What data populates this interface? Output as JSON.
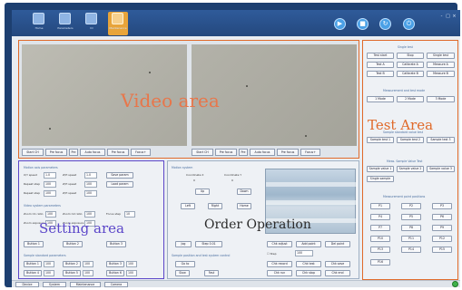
{
  "toolbar": {
    "items": [
      {
        "label": "Home",
        "icon": "home-icon"
      },
      {
        "label": "Parameters",
        "icon": "parameters-icon"
      },
      {
        "label": "IO",
        "icon": "io-icon"
      },
      {
        "label": "Maintenance",
        "icon": "maintenance-icon"
      }
    ],
    "round_buttons": [
      {
        "icon": "play-icon",
        "glyph": "▶"
      },
      {
        "icon": "stop-icon",
        "glyph": "■"
      },
      {
        "icon": "reset-icon",
        "glyph": "↻"
      },
      {
        "icon": "power-icon",
        "glyph": "⏻"
      }
    ],
    "window_controls": [
      "-",
      "□",
      "×"
    ]
  },
  "video": {
    "overlay_label": "Video area",
    "left_controls": [
      "Start CH",
      "Pre focus",
      "Pre",
      "Auto focus",
      "Pre focus",
      "Focus+"
    ],
    "right_controls": [
      "Start CH",
      "Pre focus",
      "Pre",
      "Auto focus",
      "Pre focus",
      "Focus+"
    ]
  },
  "test": {
    "overlay_label": "Test Area",
    "title": "Single test",
    "row1": [
      "Test start",
      "Stop",
      "Single test"
    ],
    "row2": [
      "Test A",
      "Calibrate A",
      "Measure A"
    ],
    "row3": [
      "Test B",
      "Calibrate B",
      "Measure B"
    ],
    "mode_title": "Measurement and test mode",
    "modes": [
      "1 Mode",
      "2 Mode",
      "3 Mode"
    ],
    "sample_title": "Sample standard value test",
    "samples": [
      "Sample test 1",
      "Sample test 2",
      "Sample test 3"
    ],
    "meas_title": "Meas. Sample Value Test",
    "meas": [
      "Sample value 1",
      "Sample value 2",
      "Sample value 3"
    ],
    "single_sample": "Single sample",
    "point_title": "Measurement point positions",
    "points": [
      "P1",
      "P2",
      "P3",
      "P4",
      "P5",
      "P6",
      "P7",
      "P8",
      "P9",
      "P10",
      "P11",
      "P12",
      "P13",
      "P14",
      "P15",
      "P16"
    ]
  },
  "setting": {
    "overlay_label": "Setting area",
    "sec1": "Motion axis parameters",
    "rows1": [
      [
        "X/Y speed",
        "1.0",
        "Z/H speed",
        "1.0",
        "Save param"
      ],
      [
        "Repeat step",
        "100",
        "Z/H speed",
        "100",
        "Load param"
      ],
      [
        "Repeat step",
        "100",
        "Z/H speed",
        "100",
        ""
      ]
    ],
    "sec2": "Video system parameters",
    "rows2": [
      [
        "Zoom C1 ratio",
        "100",
        "Zoom C2 ratio",
        "100",
        "Focus step",
        "10"
      ],
      [
        "Zoom exposure",
        "100",
        "Zoom exposure",
        "100",
        "Focus step",
        "10"
      ]
    ],
    "rows3": [
      "Button 1",
      "Button 2",
      "Button 3"
    ],
    "sec4": "Sample standard parameters",
    "rows4": [
      [
        "Button 1",
        "100",
        "Button 2",
        "100",
        "Button 3",
        "100"
      ],
      [
        "Button 4",
        "100",
        "Button 5",
        "100",
        "Button 6",
        "100"
      ]
    ]
  },
  "order": {
    "overlay_label": "Order Operation",
    "sec1": "Motion system",
    "coord_x": "Coordinate X",
    "coord_y": "Coordinate Y",
    "x_val": "0",
    "y_val": "0",
    "jog": [
      "Up",
      "Down",
      "Left",
      "Right",
      "Home"
    ],
    "row_a": [
      "Jog",
      "Step 0.01"
    ],
    "sec2": "Sample position and test system control",
    "row_b": [
      "Go to",
      "Slow",
      "Fast"
    ],
    "checkbox": "Step",
    "select_value": "100",
    "right_btns": [
      "Chk adjust",
      "Add point",
      "Del point"
    ],
    "right_btns2": [
      "Chk record",
      "Chk test",
      "Chk save"
    ],
    "right_btns3": [
      "Chk run",
      "Chk stop",
      "Chk end"
    ]
  },
  "bottom": {
    "buttons": [
      "Device",
      "System",
      "Maintenance",
      "Camera"
    ]
  }
}
